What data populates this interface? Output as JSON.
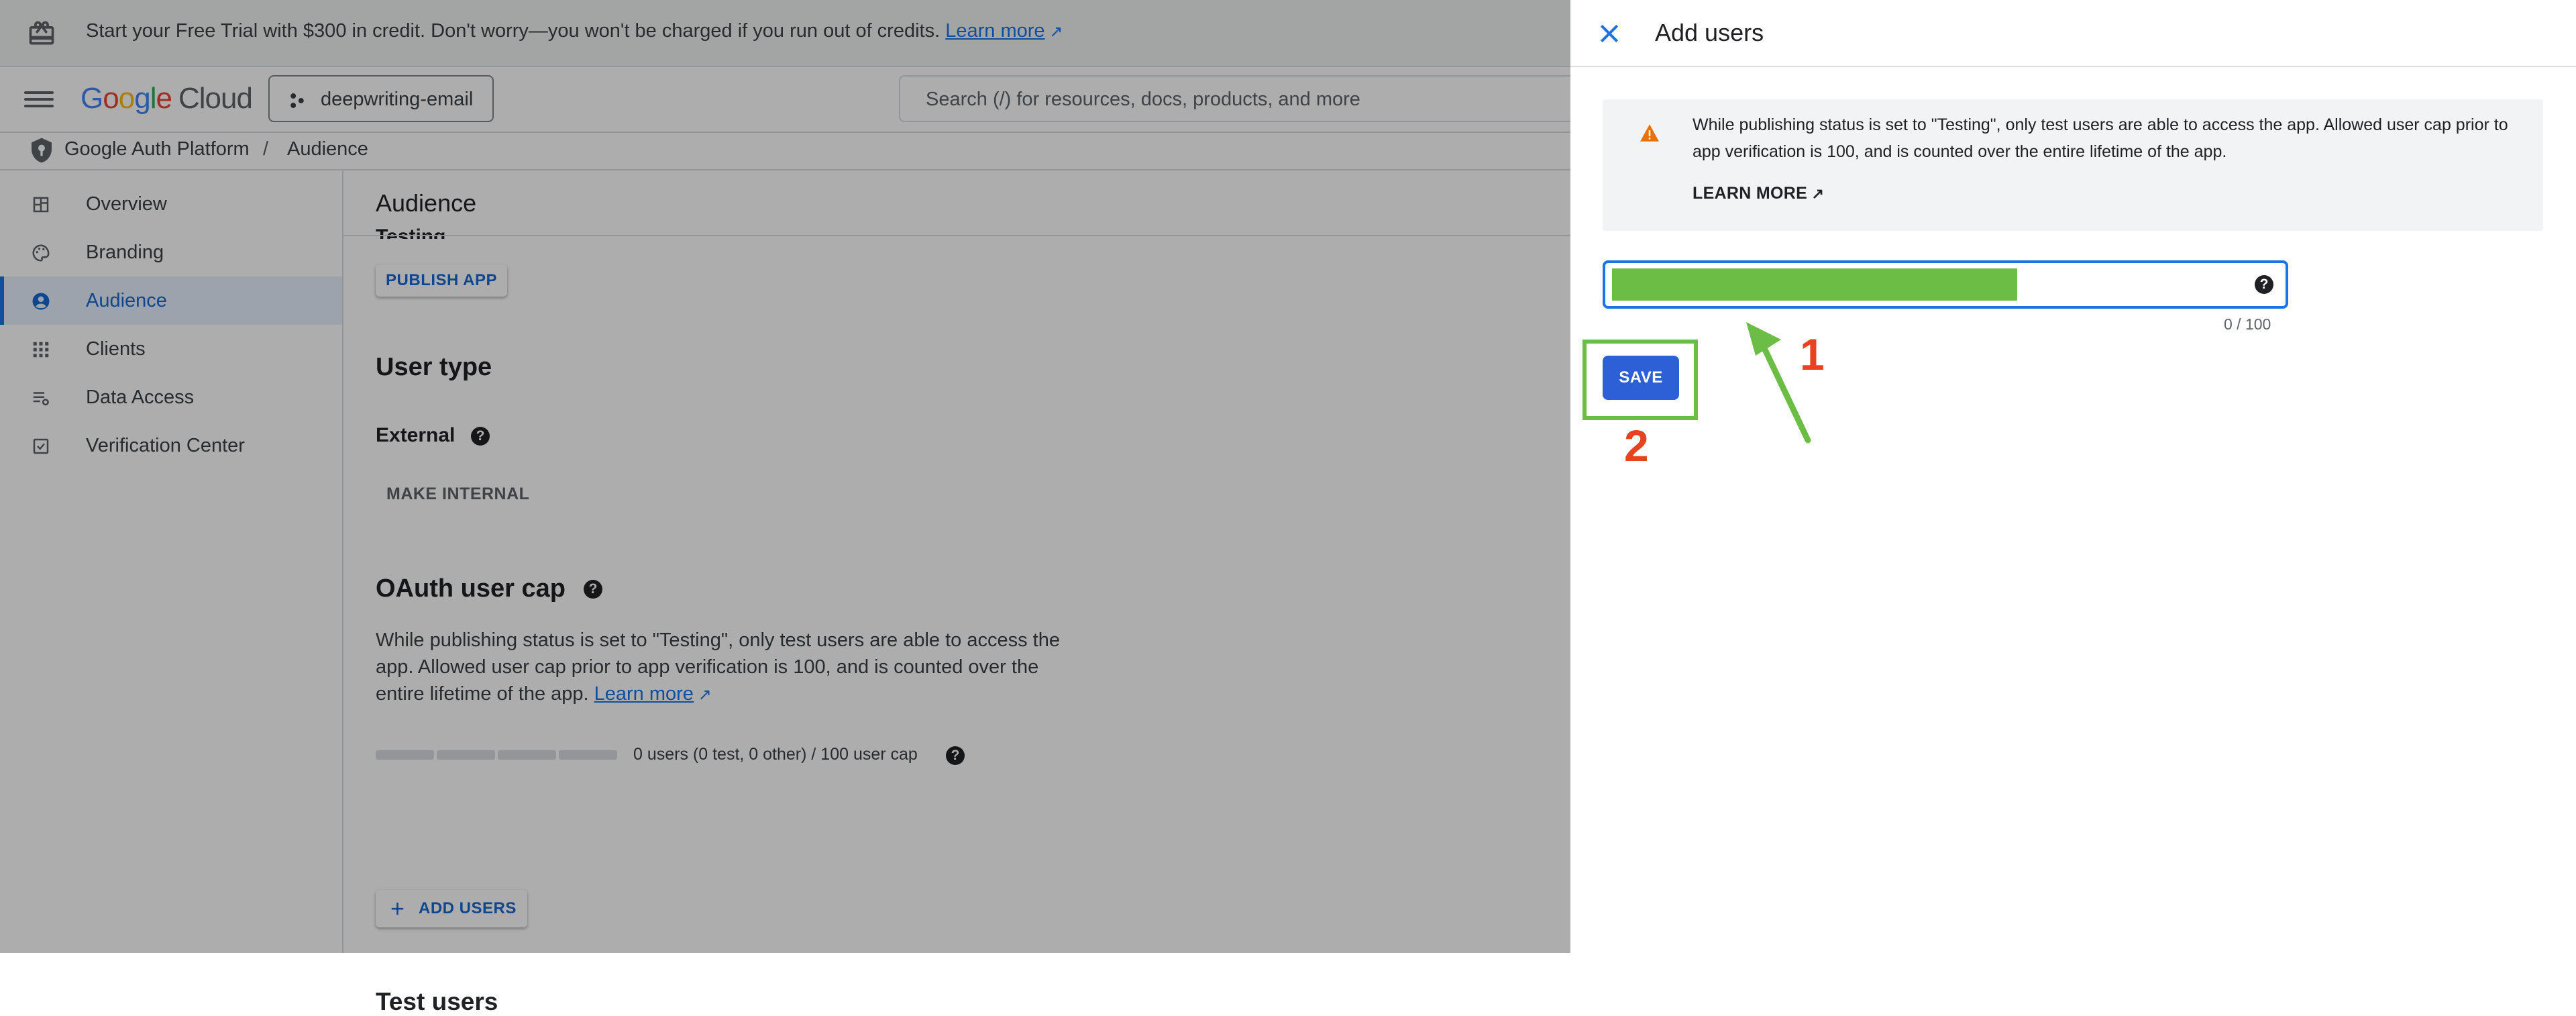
{
  "banner": {
    "text": "Start your Free Trial with $300 in credit. Don't worry—you won't be charged if you run out of credits.",
    "link": "Learn more"
  },
  "topbar": {
    "logo_google": [
      "G",
      "o",
      "o",
      "g",
      "l",
      "e"
    ],
    "logo_cloud": "Cloud",
    "project": "deepwriting-email",
    "search_placeholder": "Search (/) for resources, docs, products, and more"
  },
  "breadcrumb": {
    "root": "Google Auth Platform",
    "separator": "/",
    "current": "Audience"
  },
  "sidebar": {
    "items": [
      {
        "label": "Overview",
        "icon": "dashboard-icon"
      },
      {
        "label": "Branding",
        "icon": "palette-icon"
      },
      {
        "label": "Audience",
        "icon": "account-circle-icon",
        "active": true
      },
      {
        "label": "Clients",
        "icon": "apps-grid-icon"
      },
      {
        "label": "Data Access",
        "icon": "list-filter-icon"
      },
      {
        "label": "Verification Center",
        "icon": "checkbox-icon"
      }
    ]
  },
  "main": {
    "title": "Audience",
    "cut_heading": "Testing",
    "publish_button": "PUBLISH APP",
    "user_type_heading": "User type",
    "user_type_value": "External",
    "make_internal_button": "MAKE INTERNAL",
    "oauth_heading": "OAuth user cap",
    "oauth_text": "While publishing status is set to \"Testing\", only test users are able to access the app. Allowed user cap prior to app verification is 100, and is counted over the entire lifetime of the app.",
    "oauth_link": "Learn more",
    "cap_text": "0 users (0 test, 0 other) / 100 user cap",
    "cap_fraction": 0,
    "test_users_heading": "Test users",
    "add_users_button": "ADD USERS"
  },
  "panel": {
    "title": "Add users",
    "notice_text": "While publishing status is set to \"Testing\", only test users are able to access the app. Allowed user cap prior to app verification is 100, and is counted over the entire lifetime of the app.",
    "notice_link": "LEARN MORE",
    "input_value": "",
    "counter": "0 / 100",
    "save_button": "SAVE"
  },
  "annotations": {
    "step1": "1",
    "step2": "2",
    "highlight_color": "#6cbd45",
    "number_color": "#e8431f"
  },
  "colors": {
    "accent": "#1a73e8",
    "save_button": "#2d5fd6",
    "warning": "#e8710a"
  }
}
